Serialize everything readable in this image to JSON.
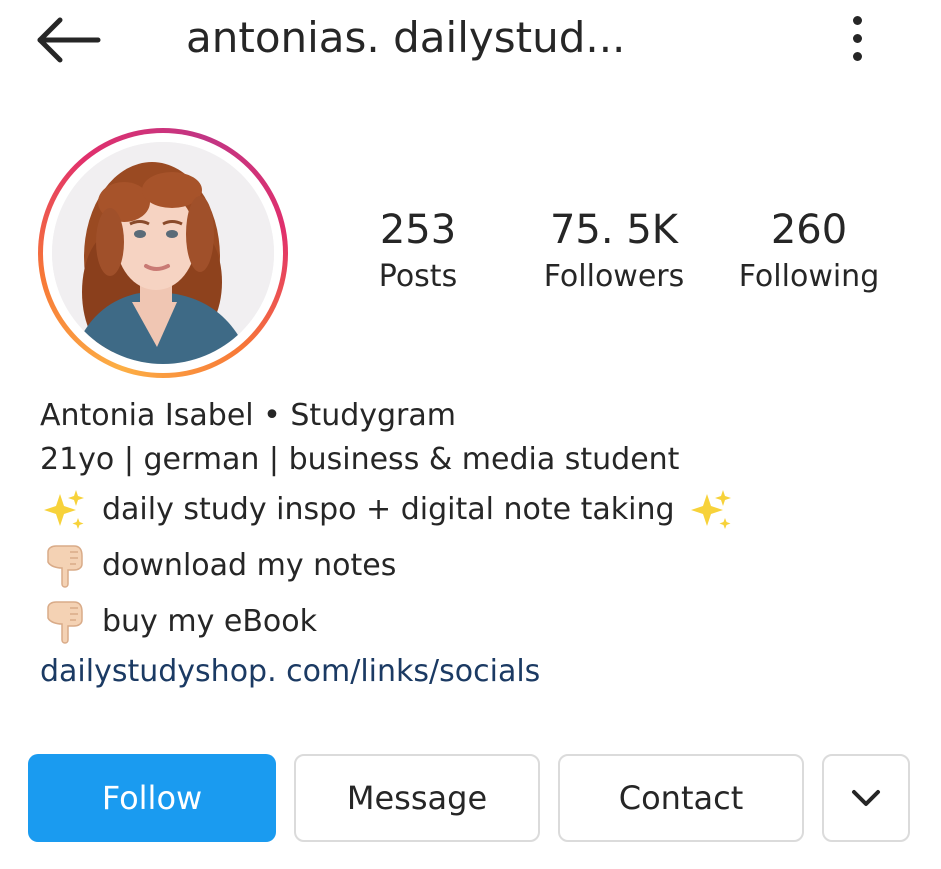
{
  "header": {
    "username": "antonias. dailystud...",
    "back_icon": "arrow-left-icon",
    "more_icon": "more-vertical-icon"
  },
  "profile": {
    "avatar_description": "profile-photo",
    "stats": [
      {
        "value": "253",
        "label": "Posts"
      },
      {
        "value": "75. 5K",
        "label": "Followers"
      },
      {
        "value": "260",
        "label": "Following"
      }
    ]
  },
  "bio": {
    "name_line": "Antonia Isabel • Studygram",
    "line2": "21yo | german | business & media student",
    "line3": "daily study inspo + digital note taking",
    "line4": "download my notes",
    "line5": "buy my eBook",
    "link": "dailystudyshop. com/links/socials"
  },
  "actions": {
    "follow_label": "Follow",
    "message_label": "Message",
    "contact_label": "Contact",
    "more_icon": "chevron-down-icon"
  },
  "colors": {
    "follow_bg": "#1a9bf0",
    "link": "#1b3a63",
    "text": "#262626",
    "border": "#dbdbdb"
  }
}
